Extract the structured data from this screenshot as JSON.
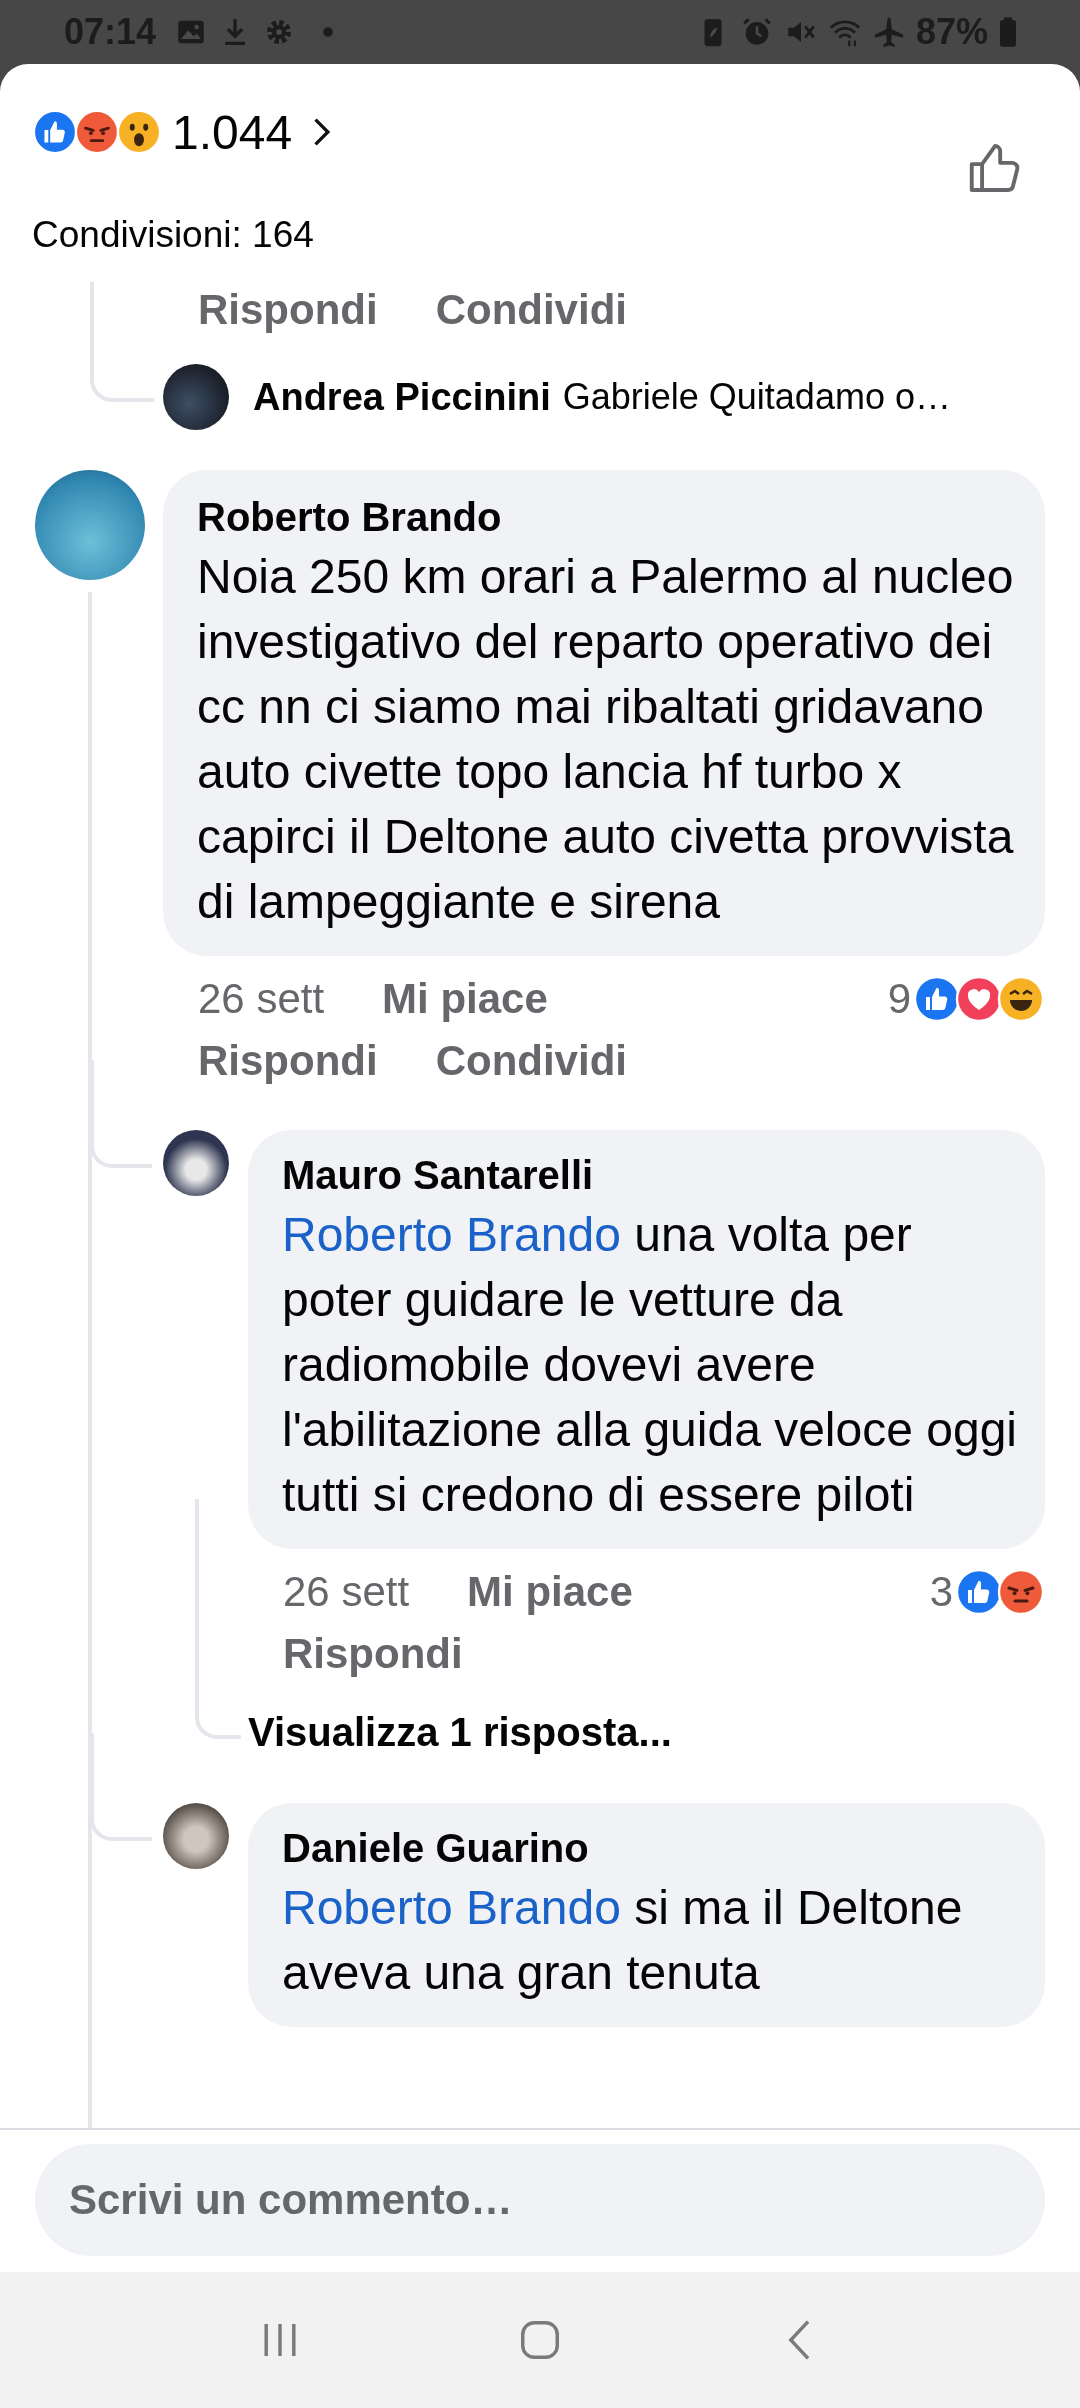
{
  "status_bar": {
    "time": "07:14",
    "battery": "87%"
  },
  "header": {
    "reactions": [
      {
        "kind": "like"
      },
      {
        "kind": "angry"
      },
      {
        "kind": "wow"
      }
    ],
    "count": "1.044",
    "shares": "Condivisioni: 164"
  },
  "previous_thread": {
    "actions": [
      "Rispondi",
      "Condividi"
    ],
    "collapsed_reply": {
      "author": "Andrea Piccinini",
      "preview": "Gabriele Quitadamo o…"
    }
  },
  "comments": [
    {
      "author": "Roberto Brando",
      "text": "Noia 250 km orari a Palermo al nucleo investigativo del reparto operativo dei cc nn ci siamo mai ribaltati gridavano auto civette topo lancia hf turbo x capirci il Deltone auto civetta provvista di lampeggiante e sirena",
      "time": "26 sett",
      "like": "Mi piace",
      "reaction_count": "9",
      "reactions": [
        {
          "kind": "like"
        },
        {
          "kind": "love"
        },
        {
          "kind": "haha"
        }
      ],
      "actions": [
        "Rispondi",
        "Condividi"
      ],
      "replies": [
        {
          "author": "Mauro Santarelli",
          "mention": "Roberto Brando",
          "text": "una volta per poter guidare le vetture da radiomobile dovevi avere l'abilitazione alla guida veloce oggi tutti si credono di essere piloti",
          "time": "26 sett",
          "like": "Mi piace",
          "reaction_count": "3",
          "reactions": [
            {
              "kind": "like"
            },
            {
              "kind": "angry"
            }
          ],
          "actions": [
            "Rispondi"
          ],
          "more": "Visualizza 1 risposta..."
        },
        {
          "author": "Daniele Guarino",
          "mention": "Roberto Brando",
          "text": "si ma il Deltone aveva una gran tenuta"
        }
      ]
    }
  ],
  "composer": {
    "placeholder": "Scrivi un commento…"
  }
}
